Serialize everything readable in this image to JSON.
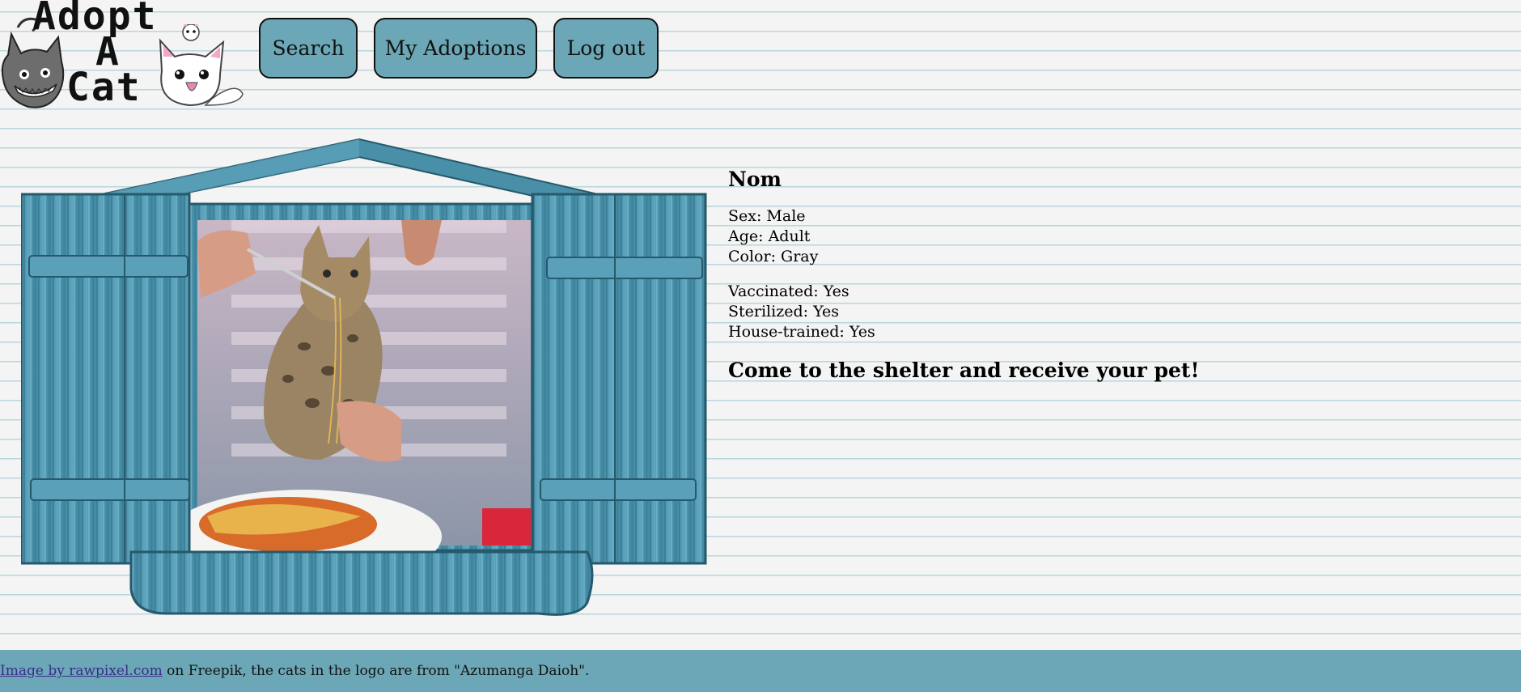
{
  "header": {
    "logo": {
      "text_lines": [
        "Adopt",
        "A",
        "Cat"
      ],
      "icon": "cat-logo-icons"
    },
    "nav": {
      "search_label": "Search",
      "adoptions_label": "My Adoptions",
      "logout_label": "Log out"
    }
  },
  "pet": {
    "name": "Nom",
    "sex": "Sex: Male",
    "age": "Age: Adult",
    "color": "Color: Gray",
    "vaccinated": "Vaccinated: Yes",
    "sterilized": "Sterilized: Yes",
    "house_trained": "House-trained: Yes",
    "call_to_action": "Come to the shelter and receive your pet!"
  },
  "footer": {
    "link_text": "Image by rawpixel.com",
    "text": " on Freepik, the cats in the logo are from \"Azumanga Daioh\"."
  },
  "colors": {
    "accent": "#6ba7b6",
    "background": "#f3f4f3",
    "window_wood": "#4f93ab"
  }
}
